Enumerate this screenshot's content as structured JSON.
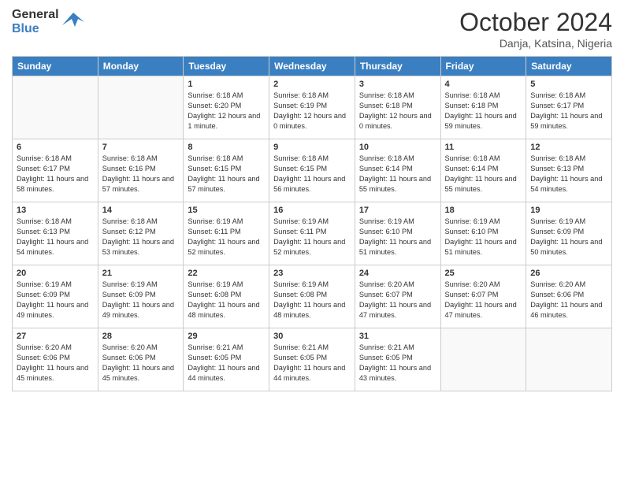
{
  "header": {
    "logo_line1": "General",
    "logo_line2": "Blue",
    "month": "October 2024",
    "location": "Danja, Katsina, Nigeria"
  },
  "days_of_week": [
    "Sunday",
    "Monday",
    "Tuesday",
    "Wednesday",
    "Thursday",
    "Friday",
    "Saturday"
  ],
  "weeks": [
    [
      {
        "day": "",
        "info": ""
      },
      {
        "day": "",
        "info": ""
      },
      {
        "day": "1",
        "info": "Sunrise: 6:18 AM\nSunset: 6:20 PM\nDaylight: 12 hours and 1 minute."
      },
      {
        "day": "2",
        "info": "Sunrise: 6:18 AM\nSunset: 6:19 PM\nDaylight: 12 hours and 0 minutes."
      },
      {
        "day": "3",
        "info": "Sunrise: 6:18 AM\nSunset: 6:18 PM\nDaylight: 12 hours and 0 minutes."
      },
      {
        "day": "4",
        "info": "Sunrise: 6:18 AM\nSunset: 6:18 PM\nDaylight: 11 hours and 59 minutes."
      },
      {
        "day": "5",
        "info": "Sunrise: 6:18 AM\nSunset: 6:17 PM\nDaylight: 11 hours and 59 minutes."
      }
    ],
    [
      {
        "day": "6",
        "info": "Sunrise: 6:18 AM\nSunset: 6:17 PM\nDaylight: 11 hours and 58 minutes."
      },
      {
        "day": "7",
        "info": "Sunrise: 6:18 AM\nSunset: 6:16 PM\nDaylight: 11 hours and 57 minutes."
      },
      {
        "day": "8",
        "info": "Sunrise: 6:18 AM\nSunset: 6:15 PM\nDaylight: 11 hours and 57 minutes."
      },
      {
        "day": "9",
        "info": "Sunrise: 6:18 AM\nSunset: 6:15 PM\nDaylight: 11 hours and 56 minutes."
      },
      {
        "day": "10",
        "info": "Sunrise: 6:18 AM\nSunset: 6:14 PM\nDaylight: 11 hours and 55 minutes."
      },
      {
        "day": "11",
        "info": "Sunrise: 6:18 AM\nSunset: 6:14 PM\nDaylight: 11 hours and 55 minutes."
      },
      {
        "day": "12",
        "info": "Sunrise: 6:18 AM\nSunset: 6:13 PM\nDaylight: 11 hours and 54 minutes."
      }
    ],
    [
      {
        "day": "13",
        "info": "Sunrise: 6:18 AM\nSunset: 6:13 PM\nDaylight: 11 hours and 54 minutes."
      },
      {
        "day": "14",
        "info": "Sunrise: 6:18 AM\nSunset: 6:12 PM\nDaylight: 11 hours and 53 minutes."
      },
      {
        "day": "15",
        "info": "Sunrise: 6:19 AM\nSunset: 6:11 PM\nDaylight: 11 hours and 52 minutes."
      },
      {
        "day": "16",
        "info": "Sunrise: 6:19 AM\nSunset: 6:11 PM\nDaylight: 11 hours and 52 minutes."
      },
      {
        "day": "17",
        "info": "Sunrise: 6:19 AM\nSunset: 6:10 PM\nDaylight: 11 hours and 51 minutes."
      },
      {
        "day": "18",
        "info": "Sunrise: 6:19 AM\nSunset: 6:10 PM\nDaylight: 11 hours and 51 minutes."
      },
      {
        "day": "19",
        "info": "Sunrise: 6:19 AM\nSunset: 6:09 PM\nDaylight: 11 hours and 50 minutes."
      }
    ],
    [
      {
        "day": "20",
        "info": "Sunrise: 6:19 AM\nSunset: 6:09 PM\nDaylight: 11 hours and 49 minutes."
      },
      {
        "day": "21",
        "info": "Sunrise: 6:19 AM\nSunset: 6:09 PM\nDaylight: 11 hours and 49 minutes."
      },
      {
        "day": "22",
        "info": "Sunrise: 6:19 AM\nSunset: 6:08 PM\nDaylight: 11 hours and 48 minutes."
      },
      {
        "day": "23",
        "info": "Sunrise: 6:19 AM\nSunset: 6:08 PM\nDaylight: 11 hours and 48 minutes."
      },
      {
        "day": "24",
        "info": "Sunrise: 6:20 AM\nSunset: 6:07 PM\nDaylight: 11 hours and 47 minutes."
      },
      {
        "day": "25",
        "info": "Sunrise: 6:20 AM\nSunset: 6:07 PM\nDaylight: 11 hours and 47 minutes."
      },
      {
        "day": "26",
        "info": "Sunrise: 6:20 AM\nSunset: 6:06 PM\nDaylight: 11 hours and 46 minutes."
      }
    ],
    [
      {
        "day": "27",
        "info": "Sunrise: 6:20 AM\nSunset: 6:06 PM\nDaylight: 11 hours and 45 minutes."
      },
      {
        "day": "28",
        "info": "Sunrise: 6:20 AM\nSunset: 6:06 PM\nDaylight: 11 hours and 45 minutes."
      },
      {
        "day": "29",
        "info": "Sunrise: 6:21 AM\nSunset: 6:05 PM\nDaylight: 11 hours and 44 minutes."
      },
      {
        "day": "30",
        "info": "Sunrise: 6:21 AM\nSunset: 6:05 PM\nDaylight: 11 hours and 44 minutes."
      },
      {
        "day": "31",
        "info": "Sunrise: 6:21 AM\nSunset: 6:05 PM\nDaylight: 11 hours and 43 minutes."
      },
      {
        "day": "",
        "info": ""
      },
      {
        "day": "",
        "info": ""
      }
    ]
  ]
}
